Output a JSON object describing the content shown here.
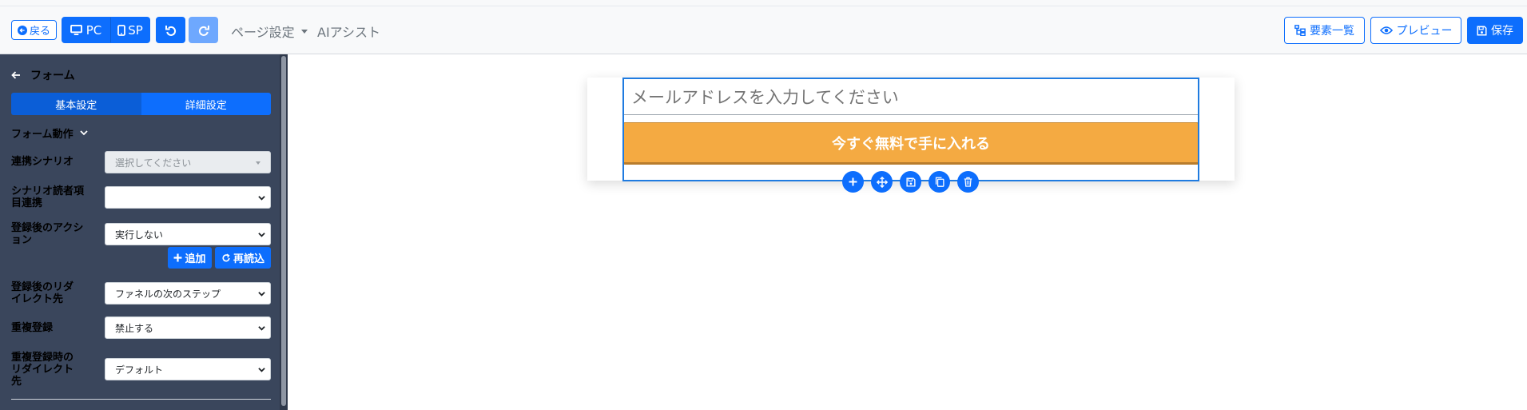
{
  "toolbar": {
    "back_label": "戻る",
    "pc_label": "PC",
    "sp_label": "SP",
    "page_settings_label": "ページ設定",
    "ai_assist_label": "AIアシスト",
    "elements_list_label": "要素一覧",
    "preview_label": "プレビュー",
    "save_label": "保存"
  },
  "sidebar": {
    "title": "フォーム",
    "tabs": [
      {
        "label": "基本設定"
      },
      {
        "label": "詳細設定"
      }
    ],
    "section_title": "フォーム動作",
    "fields": [
      {
        "label": "連携シナリオ",
        "placeholder": "選択してください"
      },
      {
        "label": "シナリオ読者項目連携",
        "value": ""
      },
      {
        "label": "登録後のアクション",
        "value": "実行しない"
      },
      {
        "label": "登録後のリダイレクト先",
        "value": "ファネルの次のステップ"
      },
      {
        "label": "重複登録",
        "value": "禁止する"
      },
      {
        "label": "重複登録時のリダイレクト先",
        "value": "デフォルト"
      }
    ],
    "add_label": "追加",
    "reload_label": "再読込"
  },
  "canvas": {
    "email_placeholder": "メールアドレスを入力してください",
    "cta_label": "今すぐ無料で手に入れる",
    "tools": [
      "plus-icon",
      "move-icon",
      "save-icon",
      "copy-icon",
      "trash-icon"
    ]
  },
  "colors": {
    "primary": "#0d6efd",
    "sidebar_bg": "#3a465c",
    "cta": "#f4aa42"
  }
}
